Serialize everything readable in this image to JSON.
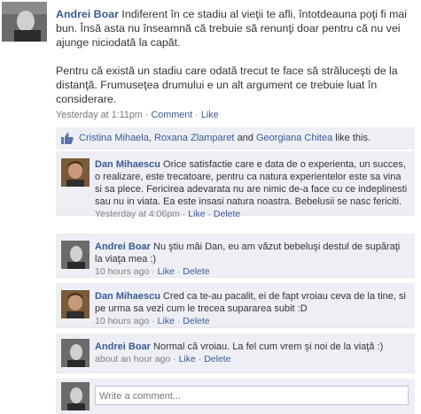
{
  "post": {
    "author": "Andrei Boar",
    "paragraph1": "Indiferent în ce stadiu al vieţii te afli, întotdeauna poţi fi mai bun. Însă asta nu înseamnă că trebuie să renunţi doar pentru că nu vei ajunge niciodată la capăt.",
    "paragraph2": "Pentru că există un stadiu care odată trecut te face să străluceşti de la distanţă. Frumuseţea drumului e un alt argument ce trebuie luat în considerare.",
    "timestamp": "Yesterday at 1:11pm",
    "comment_label": "Comment",
    "like_label": "Like",
    "separator": "·"
  },
  "likes": {
    "names": [
      "Cristina Mihaela",
      "Roxana Zlamparet",
      "Georgiana Chitea"
    ],
    "comma": ",",
    "and_word": "and",
    "suffix": "like this."
  },
  "comments": [
    {
      "author": "Dan Mihaescu",
      "text": "Orice satisfactie care e data de o experienta, un succes, o realizare, este trecatoare, pentru ca natura experientelor este sa vina si sa plece. Fericirea adevarata nu are nimic de-a face cu ce indeplinesti sau nu in viata. Ea este insasi natura noastra. Bebelusii se nasc fericiti.",
      "time": "Yesterday at 4:06pm",
      "like": "Like",
      "delete": "Delete"
    },
    {
      "author": "Andrei Boar",
      "text": "Nu ştiu mâi Dan, eu am văzut bebeluşi destul de supăraţi la viaţa mea :)",
      "time": "10 hours ago",
      "like": "Like",
      "delete": "Delete"
    },
    {
      "author": "Dan Mihaescu",
      "text": "Cred ca te-au pacalit, ei de fapt vroiau ceva de la tine, si pe urma sa vezi cum le trecea supararea subit :D",
      "time": "10 hours ago",
      "like": "Like",
      "delete": "Delete"
    },
    {
      "author": "Andrei Boar",
      "text": "Normal că vroiau. La fel cum vrem şi noi de la viaţă :)",
      "time": "about an hour ago",
      "like": "Like",
      "delete": "Delete"
    }
  ],
  "write_comment": {
    "placeholder": "Write a comment..."
  },
  "colors": {
    "link": "#3b5998",
    "panel": "#edeff4",
    "meta": "#777777"
  },
  "icons": {
    "like": "thumbs-up-icon"
  }
}
